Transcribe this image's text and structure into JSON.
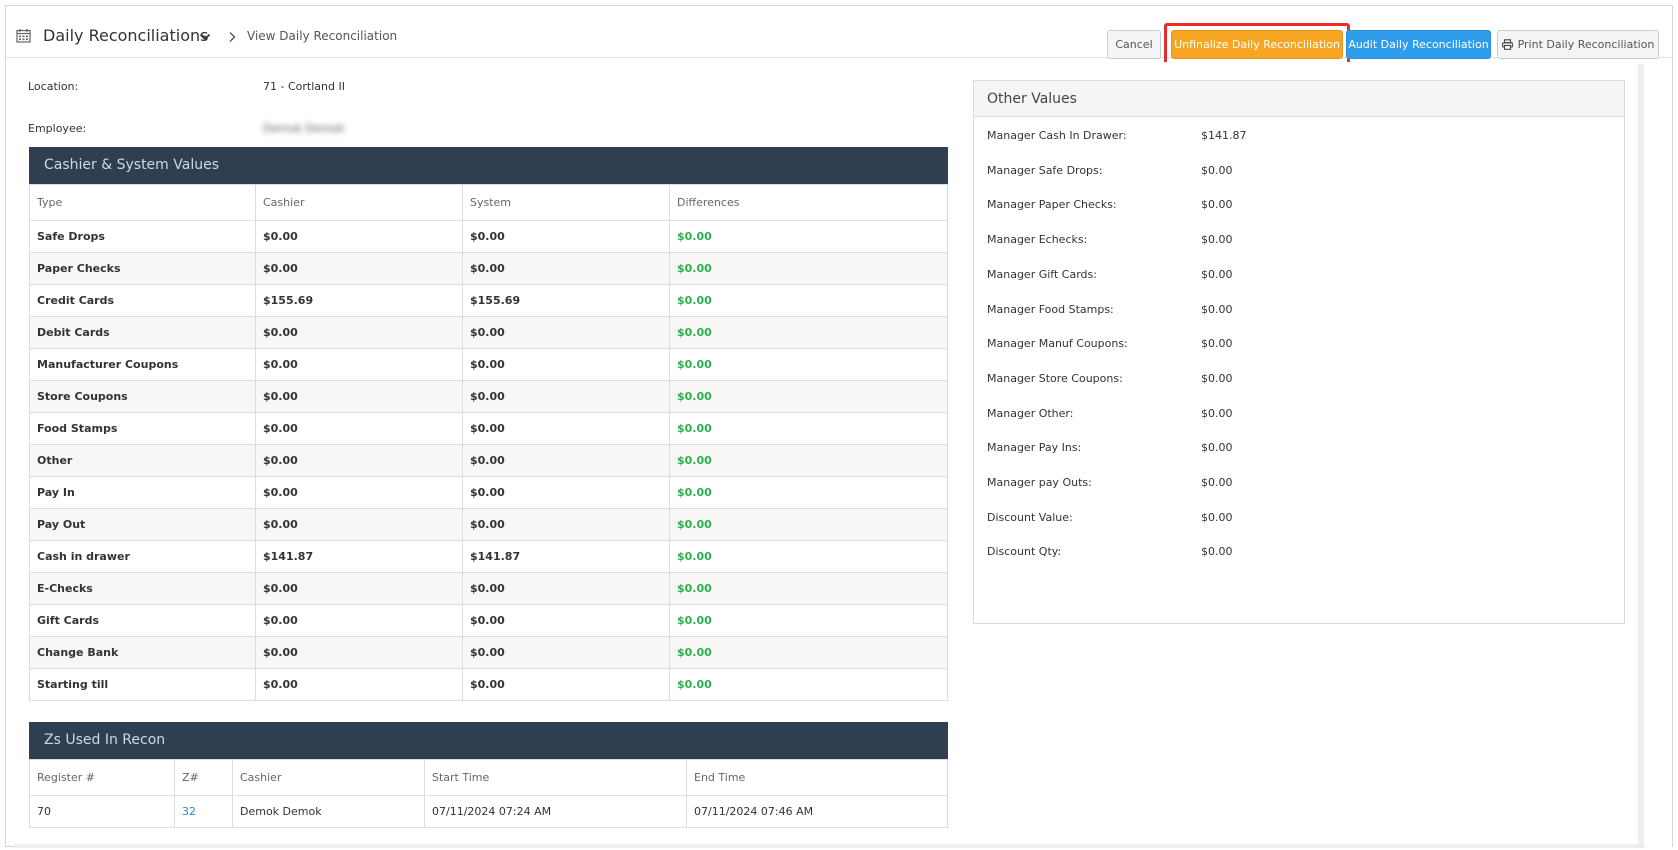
{
  "header": {
    "title": "Daily Reconciliations",
    "breadcrumb": "View Daily Reconciliation",
    "buttons": {
      "cancel": "Cancel",
      "unfinalize": "Unfinalize Daily Reconciliation",
      "audit": "Audit Daily Reconciliation",
      "print": "Print Daily Reconciliation"
    }
  },
  "info": {
    "location_label": "Location:",
    "location_value": "71 - Cortland II",
    "employee_label": "Employee:",
    "employee_value": "Demok Demok"
  },
  "cashier_system": {
    "title": "Cashier & System Values",
    "columns": [
      "Type",
      "Cashier",
      "System",
      "Differences"
    ],
    "rows": [
      [
        "Safe Drops",
        "$0.00",
        "$0.00",
        "$0.00"
      ],
      [
        "Paper Checks",
        "$0.00",
        "$0.00",
        "$0.00"
      ],
      [
        "Credit Cards",
        "$155.69",
        "$155.69",
        "$0.00"
      ],
      [
        "Debit Cards",
        "$0.00",
        "$0.00",
        "$0.00"
      ],
      [
        "Manufacturer Coupons",
        "$0.00",
        "$0.00",
        "$0.00"
      ],
      [
        "Store Coupons",
        "$0.00",
        "$0.00",
        "$0.00"
      ],
      [
        "Food Stamps",
        "$0.00",
        "$0.00",
        "$0.00"
      ],
      [
        "Other",
        "$0.00",
        "$0.00",
        "$0.00"
      ],
      [
        "Pay In",
        "$0.00",
        "$0.00",
        "$0.00"
      ],
      [
        "Pay Out",
        "$0.00",
        "$0.00",
        "$0.00"
      ],
      [
        "Cash in drawer",
        "$141.87",
        "$141.87",
        "$0.00"
      ],
      [
        "E-Checks",
        "$0.00",
        "$0.00",
        "$0.00"
      ],
      [
        "Gift Cards",
        "$0.00",
        "$0.00",
        "$0.00"
      ],
      [
        "Change Bank",
        "$0.00",
        "$0.00",
        "$0.00"
      ],
      [
        "Starting till",
        "$0.00",
        "$0.00",
        "$0.00"
      ]
    ]
  },
  "zs": {
    "title": "Zs Used In Recon",
    "columns": [
      "Register #",
      "Z#",
      "Cashier",
      "Start Time",
      "End Time"
    ],
    "rows": [
      [
        "70",
        "32",
        "Demok Demok",
        "07/11/2024 07:24 AM",
        "07/11/2024 07:46 AM"
      ]
    ]
  },
  "other_values": {
    "title": "Other Values",
    "rows": [
      [
        "Manager Cash In Drawer:",
        "$141.87"
      ],
      [
        "Manager Safe Drops:",
        "$0.00"
      ],
      [
        "Manager Paper Checks:",
        "$0.00"
      ],
      [
        "Manager Echecks:",
        "$0.00"
      ],
      [
        "Manager Gift Cards:",
        "$0.00"
      ],
      [
        "Manager Food Stamps:",
        "$0.00"
      ],
      [
        "Manager Manuf Coupons:",
        "$0.00"
      ],
      [
        "Manager Store Coupons:",
        "$0.00"
      ],
      [
        "Manager Other:",
        "$0.00"
      ],
      [
        "Manager Pay Ins:",
        "$0.00"
      ],
      [
        "Manager pay Outs:",
        "$0.00"
      ],
      [
        "Discount Value:",
        "$0.00"
      ],
      [
        "Discount Qty:",
        "$0.00"
      ]
    ]
  },
  "colors": {
    "panel_header": "#2f3e50",
    "unfinalize_button": "#f6a623",
    "audit_button": "#2f9cec",
    "difference_green": "#2bb24c",
    "highlight_red": "#e52d2d"
  },
  "icons": {
    "title": "calendar-icon",
    "title_dropdown": "chevron-down-icon",
    "breadcrumb_separator": "chevron-right-icon",
    "print": "printer-icon"
  }
}
